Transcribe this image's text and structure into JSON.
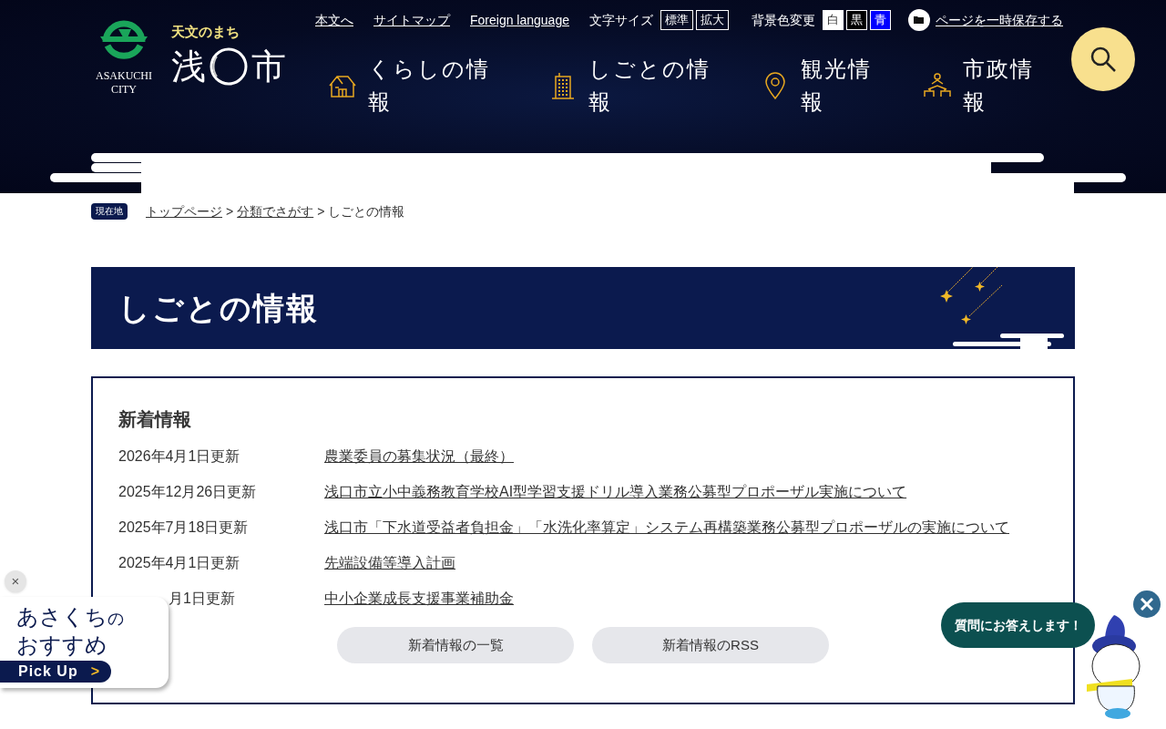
{
  "header": {
    "logo": {
      "city_en_1": "ASAKUCHI",
      "city_en_2": "CITY",
      "tagline": "天文のまち",
      "name_1": "浅",
      "name_2": "市"
    },
    "utility_links": [
      "本文へ",
      "サイトマップ",
      "Foreign language"
    ],
    "font_size": {
      "label": "文字サイズ",
      "options": [
        {
          "label": "標準",
          "selected": false
        },
        {
          "label": "拡大",
          "selected": false
        }
      ]
    },
    "bg_color": {
      "label": "背景色変更",
      "options": [
        {
          "label": "白",
          "kind": "white",
          "selected": false
        },
        {
          "label": "黒",
          "kind": "black",
          "selected": false
        },
        {
          "label": "青",
          "kind": "blue",
          "selected": false
        }
      ]
    },
    "save_link": "ページを一時保存する",
    "nav": [
      {
        "kind": "house",
        "label": "くらしの情報"
      },
      {
        "kind": "building",
        "label": "しごとの情報"
      },
      {
        "kind": "pin",
        "label": "観光情報"
      },
      {
        "kind": "people",
        "label": "市政情報"
      }
    ]
  },
  "breadcrumb": {
    "badge": "現在地",
    "links": [
      "トップページ",
      "分類でさがす"
    ],
    "current": "しごとの情報"
  },
  "page_title": "しごとの情報",
  "news": {
    "heading": "新着情報",
    "items": [
      {
        "date": "2026年4月1日更新",
        "title": "農業委員の募集状況（最終）"
      },
      {
        "date": "2025年12月26日更新",
        "title": "浅口市立小中義務教育学校AI型学習支援ドリル導入業務公募型プロポーザル実施について"
      },
      {
        "date": "2025年7月18日更新",
        "title": "浅口市「下水道受益者負担金」「水洗化率算定」システム再構築業務公募型プロポーザルの実施について"
      },
      {
        "date": "2025年4月1日更新",
        "title": "先端設備等導入計画"
      },
      {
        "date": "月1日更新",
        "title": "中小企業成長支援事業補助金",
        "partly_hidden": true
      }
    ],
    "buttons": [
      "新着情報の一覧",
      "新着情報のRSS"
    ]
  },
  "pickup": {
    "close": "×",
    "line_1": "あさくちの",
    "line_2": "おすすめ",
    "button": "Pick Up",
    "arrow": ">"
  },
  "chat": {
    "bubble": "質問にお答えします！"
  }
}
